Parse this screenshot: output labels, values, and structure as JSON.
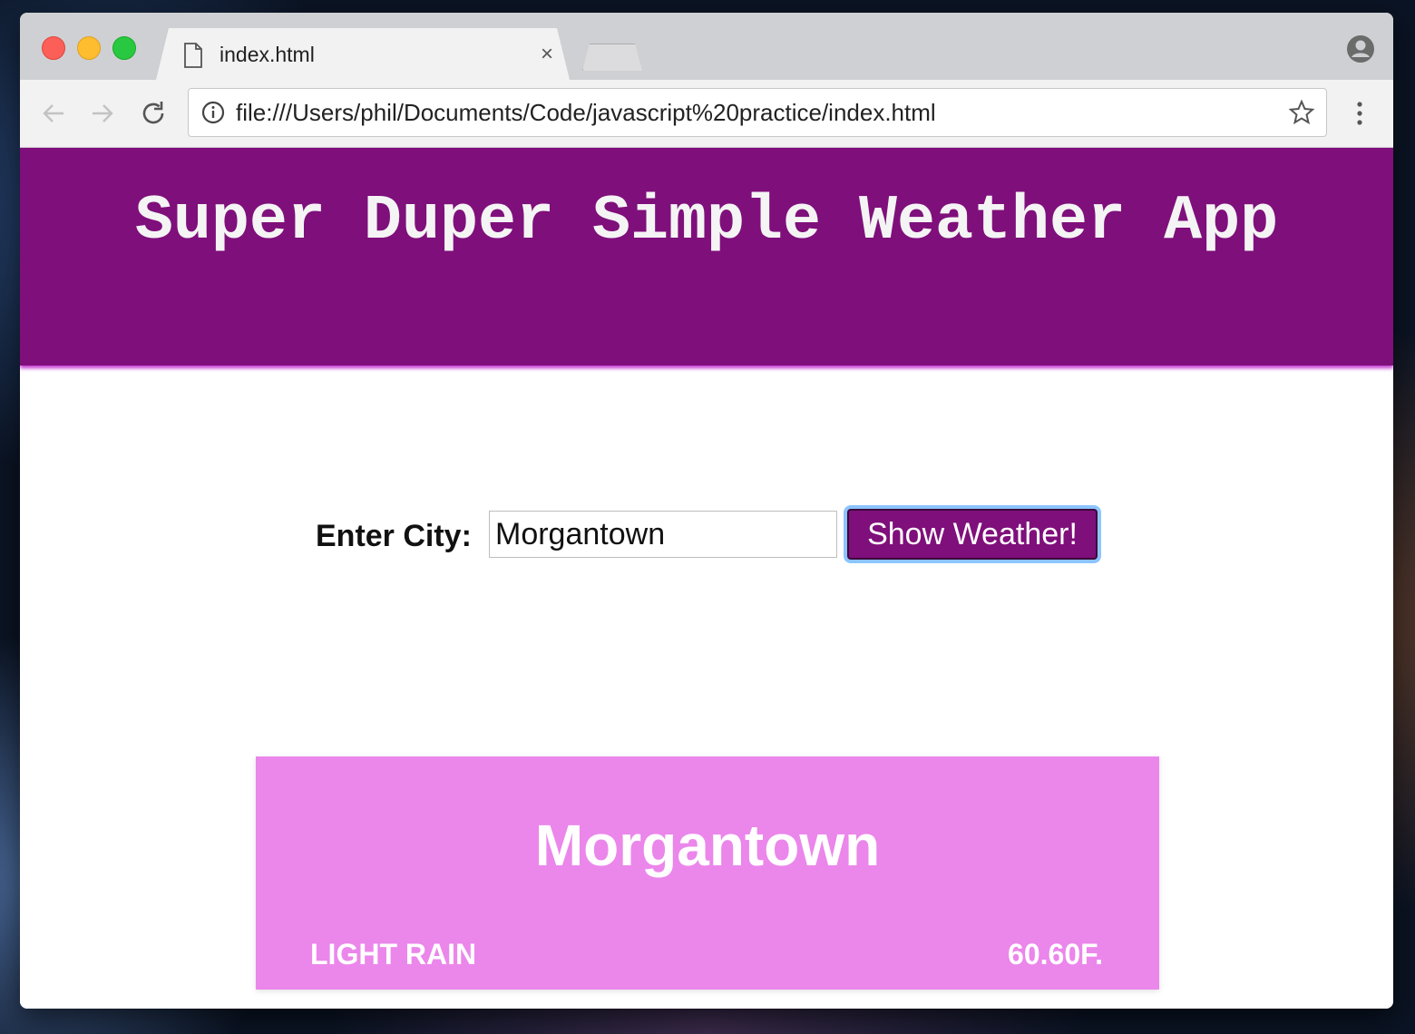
{
  "browser": {
    "tab": {
      "title": "index.html",
      "close_glyph": "×"
    },
    "address_bar": {
      "url": "file:///Users/phil/Documents/Code/javascript%20practice/index.html"
    },
    "icons": [
      "back-arrow-icon",
      "forward-arrow-icon",
      "reload-icon",
      "info-icon",
      "star-icon",
      "menu-icon",
      "profile-icon",
      "file-icon"
    ]
  },
  "app": {
    "title": "Super Duper Simple Weather App",
    "header_color": "#7f0f7b"
  },
  "form": {
    "label": "Enter City:",
    "city_value": "Morgantown",
    "button_label": "Show Weather!"
  },
  "weather_card": {
    "city": "Morgantown",
    "description": "LIGHT RAIN",
    "temperature": "60.60F.",
    "background": "#eb86eb"
  }
}
